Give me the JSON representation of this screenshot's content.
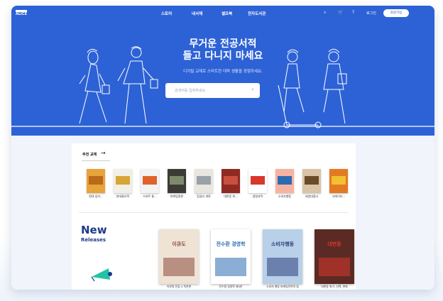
{
  "brand": {
    "logo_text": "ALICE"
  },
  "header": {
    "nav": [
      "스토어",
      "내서재",
      "셀프북",
      "전자도서관"
    ],
    "login_label": "로그인",
    "join_label": "회원가입"
  },
  "hero": {
    "title_line1": "무거운 전공서적",
    "title_line2": "들고 다니지 마세요",
    "subtitle": "디지털 교재로 스마트한 대학 생활을 경험하세요.",
    "search_placeholder": "검색어를 입력하세요."
  },
  "recommended": {
    "title": "추천 교재",
    "books": [
      {
        "label": "현대 십자...",
        "color": "#e8a33a",
        "accent": "#b86a18"
      },
      {
        "label": "현대물리학",
        "color": "#f1efe6",
        "accent": "#d6a535"
      },
      {
        "label": "스마트 통...",
        "color": "#f3f3f3",
        "accent": "#e0622a"
      },
      {
        "label": "마케팅원론",
        "color": "#3d3b36",
        "accent": "#7f8a6d"
      },
      {
        "label": "컴퓨터 개론",
        "color": "#e8e6df",
        "accent": "#9aa0a8"
      },
      {
        "label": "대변동 위...",
        "color": "#8f2a22",
        "accent": "#c9503f"
      },
      {
        "label": "생명과학",
        "color": "#ffffff",
        "accent": "#d9362c"
      },
      {
        "label": "소비자행동",
        "color": "#f7b3a1",
        "accent": "#2c6bb0"
      },
      {
        "label": "세법대중사",
        "color": "#d9c4a7",
        "accent": "#6b4b2a"
      },
      {
        "label": "크레이티...",
        "color": "#e27a21",
        "accent": "#f2c030"
      }
    ]
  },
  "new_releases": {
    "title": "New",
    "subtitle": "Releases",
    "books": [
      {
        "title": "아큐정 전집 4 독한편",
        "cover_text": "이큐도",
        "color": "#efe3d6",
        "accent": "#8a4a3a"
      },
      {
        "title": "전수환 경영학 제3판",
        "cover_text": "전수환 경영학",
        "color": "#ffffff",
        "accent": "#2c6bb0"
      },
      {
        "title": "소비자 행동 마케팅전략적 접",
        "cover_text": "소비자행동",
        "color": "#b8d0e8",
        "accent": "#2c3e7a"
      },
      {
        "title": "대변동 위기, 선택, 변화",
        "cover_text": "대변동",
        "color": "#5b2a24",
        "accent": "#d9362c"
      }
    ]
  }
}
